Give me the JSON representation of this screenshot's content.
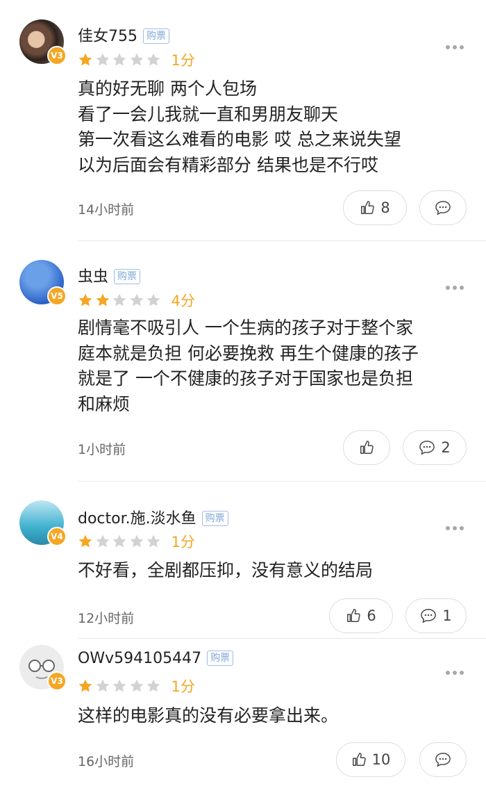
{
  "reviews": [
    {
      "username": "佳女755",
      "tag": "购票",
      "level": "V3",
      "rating": 1,
      "score_label": "1分",
      "lines": [
        "真的好无聊 两个人包场",
        "看了一会儿我就一直和男朋友聊天",
        "第一次看这么难看的电影 哎 总之来说失望",
        "以为后面会有精彩部分 结果也是不行哎"
      ],
      "time": "14小时前",
      "likes": "8",
      "comments": ""
    },
    {
      "username": "虫虫",
      "tag": "购票",
      "level": "V5",
      "rating": 2,
      "score_label": "4分",
      "lines": [
        "剧情毫不吸引人 一个生病的孩子对于整个家",
        "庭本就是负担 何必要挽救 再生个健康的孩子",
        "就是了 一个不健康的孩子对于国家也是负担",
        "和麻烦"
      ],
      "time": "1小时前",
      "likes": "",
      "comments": "2"
    },
    {
      "username": "doctor.施.淡水鱼",
      "tag": "购票",
      "level": "V4",
      "rating": 1,
      "score_label": "1分",
      "lines": [
        "不好看，全剧都压抑，没有意义的结局"
      ],
      "time": "12小时前",
      "likes": "6",
      "comments": "1"
    },
    {
      "username": "OWv594105447",
      "tag": "购票",
      "level": "V3",
      "rating": 1,
      "score_label": "1分",
      "lines": [
        "这样的电影真的没有必要拿出来。"
      ],
      "time": "16小时前",
      "likes": "10",
      "comments": ""
    }
  ],
  "colors": {
    "star_on": "#f5a623",
    "star_off": "#d2d2d2",
    "tag": "#7fa7d8",
    "badge": "#f5a623"
  },
  "icons": {
    "like": "thumbs-up-icon",
    "comment": "comment-bubble-icon",
    "more": "more-dots-icon"
  }
}
